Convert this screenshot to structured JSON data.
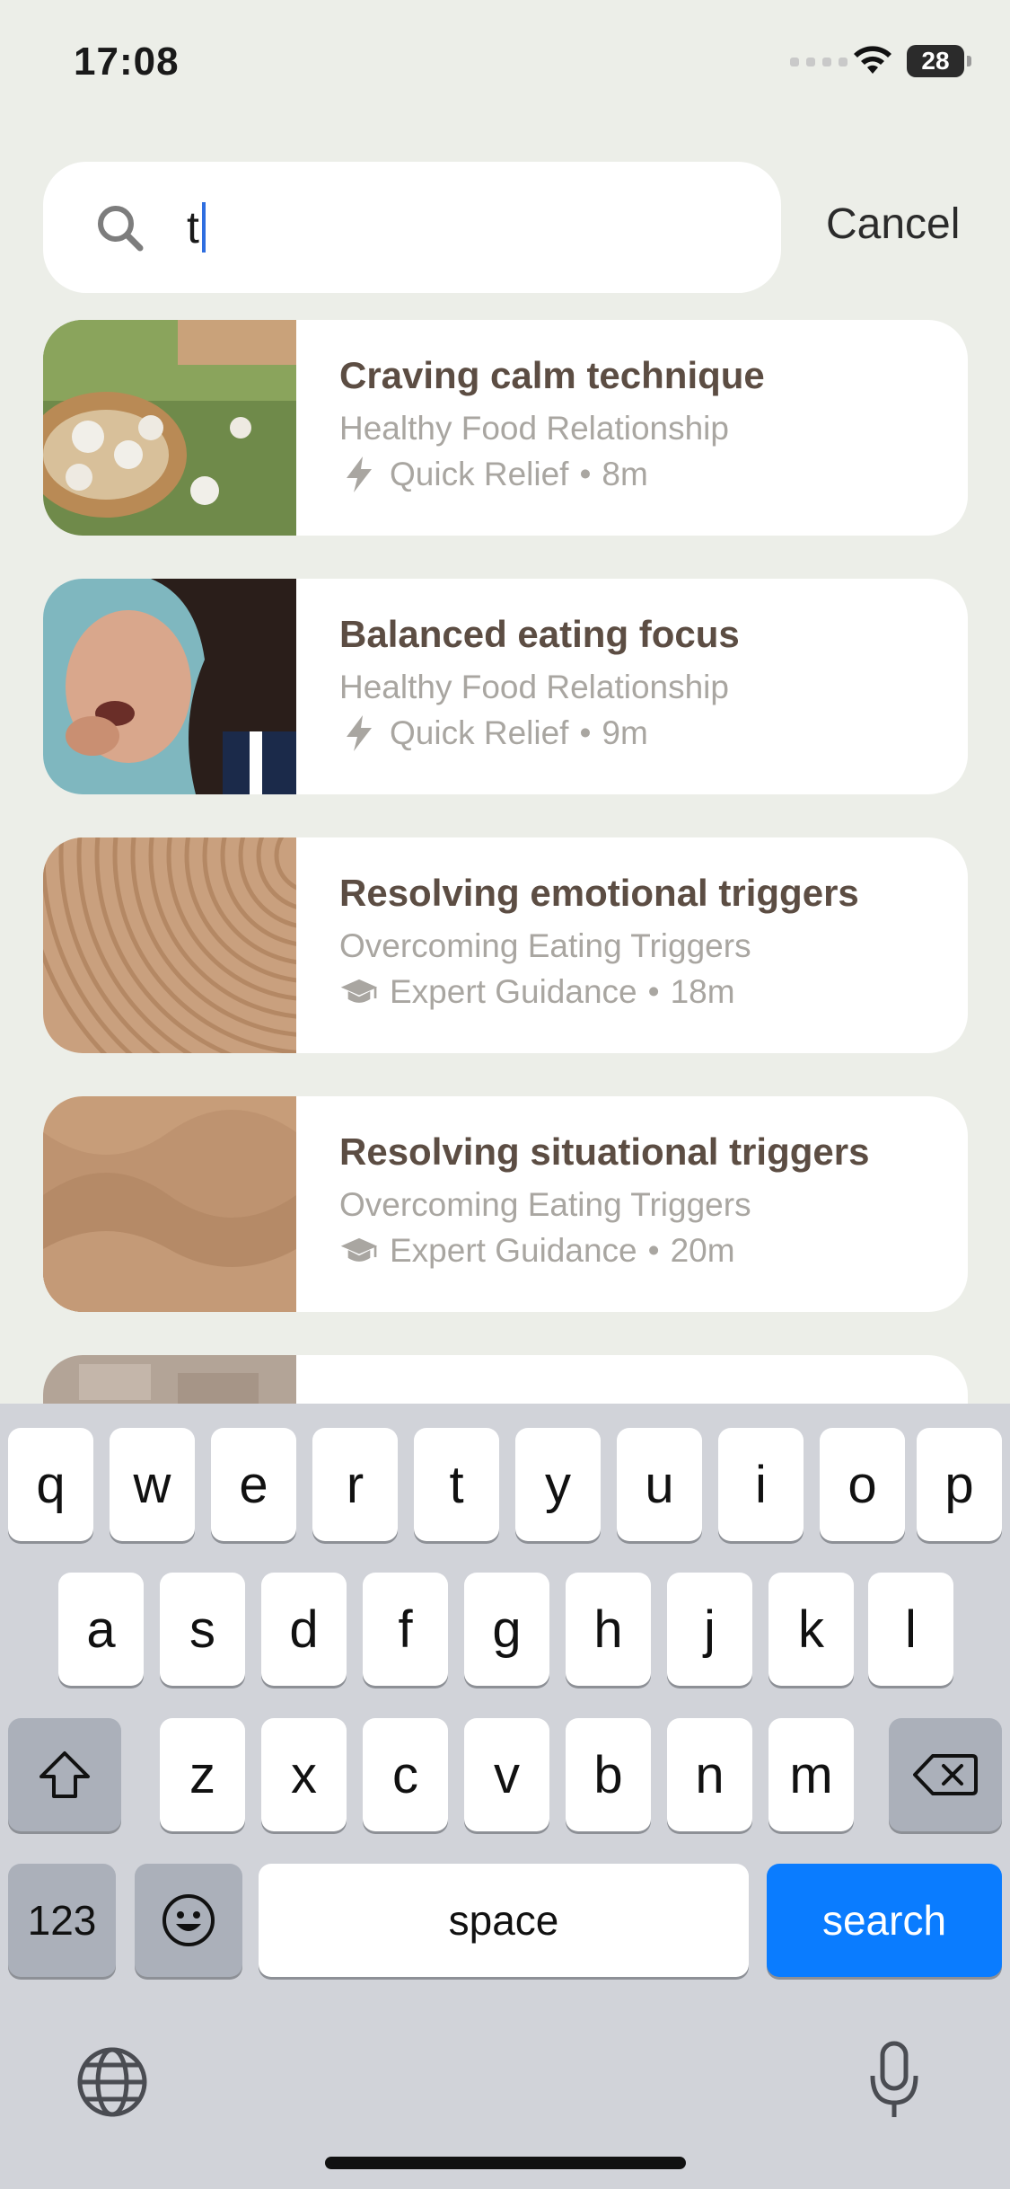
{
  "status_bar": {
    "time": "17:08",
    "battery": "28"
  },
  "search": {
    "query": "t",
    "cancel_label": "Cancel"
  },
  "results": [
    {
      "title": "Craving calm technique",
      "subtitle": "Healthy Food Relationship",
      "category": "Quick Relief",
      "duration": "8m",
      "icon": "lightning-icon"
    },
    {
      "title": "Balanced eating focus",
      "subtitle": "Healthy Food Relationship",
      "category": "Quick Relief",
      "duration": "9m",
      "icon": "lightning-icon"
    },
    {
      "title": "Resolving emotional triggers",
      "subtitle": "Overcoming Eating Triggers",
      "category": "Expert Guidance",
      "duration": "18m",
      "icon": "graduation-cap-icon"
    },
    {
      "title": "Resolving situational triggers",
      "subtitle": "Overcoming Eating Triggers",
      "category": "Expert Guidance",
      "duration": "20m",
      "icon": "graduation-cap-icon"
    },
    {
      "title": "",
      "subtitle": "",
      "category": "",
      "duration": "",
      "icon": ""
    }
  ],
  "keyboard": {
    "row1": [
      "q",
      "w",
      "e",
      "r",
      "t",
      "y",
      "u",
      "i",
      "o",
      "p"
    ],
    "row2": [
      "a",
      "s",
      "d",
      "f",
      "g",
      "h",
      "j",
      "k",
      "l"
    ],
    "row3": [
      "z",
      "x",
      "c",
      "v",
      "b",
      "n",
      "m"
    ],
    "numbers_label": "123",
    "space_label": "space",
    "search_label": "search"
  },
  "colors": {
    "background": "#eceee8",
    "accent": "#0a7cff",
    "title": "#5c4d43",
    "muted": "#a9a6a1"
  }
}
